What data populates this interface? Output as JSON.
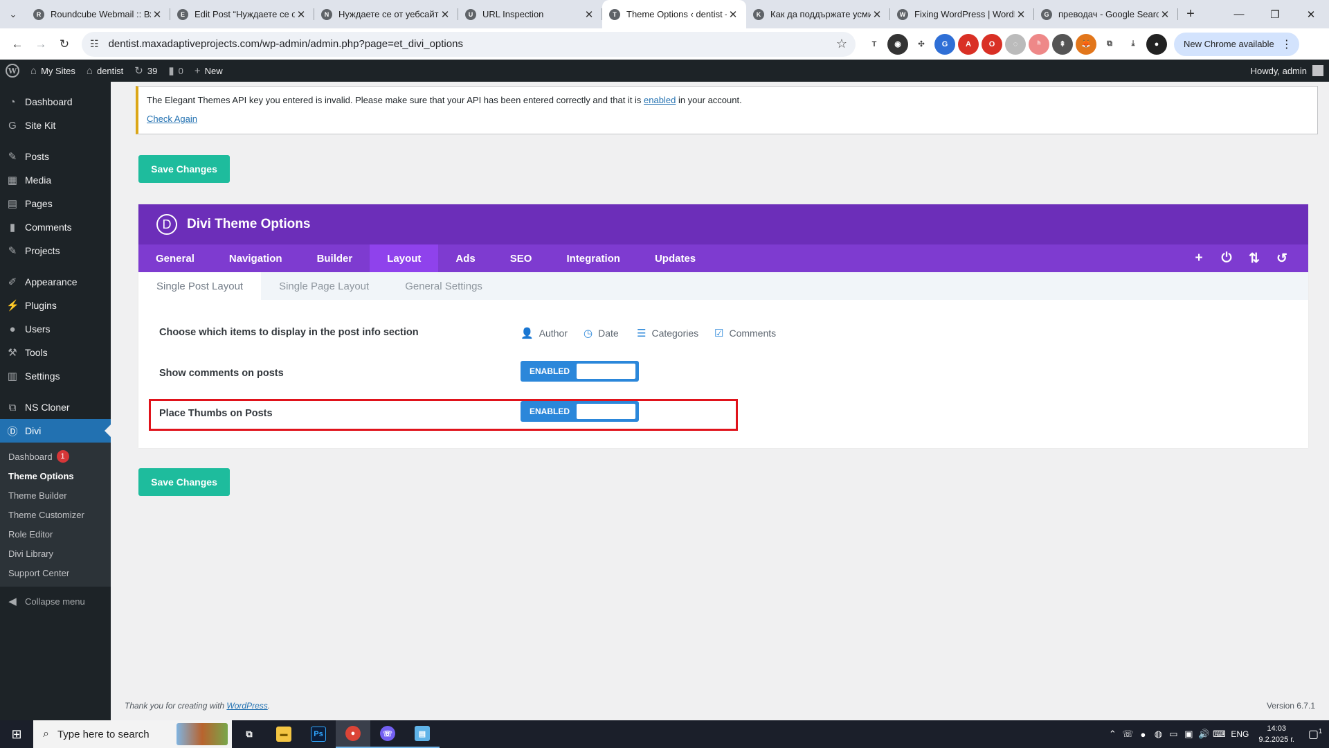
{
  "browser": {
    "tabs": [
      {
        "title": "Roundcube Webmail :: Вх",
        "favicon": "R"
      },
      {
        "title": "Edit Post “Нуждаете се от",
        "favicon": "E"
      },
      {
        "title": "Нуждаете се от уебсайт?",
        "favicon": "N"
      },
      {
        "title": "URL Inspection",
        "favicon": "U"
      },
      {
        "title": "Theme Options ‹ dentist –",
        "favicon": "T",
        "active": true
      },
      {
        "title": "Как да поддържате усми",
        "favicon": "K"
      },
      {
        "title": "Fixing WordPress | WordP",
        "favicon": "W"
      },
      {
        "title": "преводач - Google Searc",
        "favicon": "G"
      }
    ],
    "url": "dentist.maxadaptiveprojects.com/wp-admin/admin.php?page=et_divi_options",
    "new_chrome_label": "New Chrome available",
    "extensions": [
      "translate-icon",
      "accounts-icon",
      "puzzle-icon",
      "translate-g-icon",
      "adblock-icon",
      "opera-icon",
      "chat-icon",
      "tag-icon",
      "cursor-icon",
      "metamask-icon",
      "extensions-icon",
      "download-icon",
      "profile-icon"
    ]
  },
  "adminbar": {
    "my_sites": "My Sites",
    "site": "dentist",
    "updates": "39",
    "comments": "0",
    "new": "New",
    "howdy": "Howdy, admin"
  },
  "sidebar": {
    "items": [
      {
        "label": "Dashboard",
        "icon": "dashboard-icon"
      },
      {
        "label": "Site Kit",
        "icon": "sitekit-icon"
      },
      {
        "label": "Posts",
        "icon": "posts-icon"
      },
      {
        "label": "Media",
        "icon": "media-icon"
      },
      {
        "label": "Pages",
        "icon": "pages-icon"
      },
      {
        "label": "Comments",
        "icon": "comments-icon"
      },
      {
        "label": "Projects",
        "icon": "projects-icon"
      },
      {
        "label": "Appearance",
        "icon": "appearance-icon"
      },
      {
        "label": "Plugins",
        "icon": "plugins-icon"
      },
      {
        "label": "Users",
        "icon": "users-icon"
      },
      {
        "label": "Tools",
        "icon": "tools-icon"
      },
      {
        "label": "Settings",
        "icon": "settings-icon"
      },
      {
        "label": "NS Cloner",
        "icon": "cloner-icon"
      },
      {
        "label": "Divi",
        "icon": "divi-icon"
      }
    ],
    "divi_sub": [
      {
        "label": "Dashboard",
        "badge": "1"
      },
      {
        "label": "Theme Options"
      },
      {
        "label": "Theme Builder"
      },
      {
        "label": "Theme Customizer"
      },
      {
        "label": "Role Editor"
      },
      {
        "label": "Divi Library"
      },
      {
        "label": "Support Center"
      }
    ],
    "collapse": "Collapse menu"
  },
  "notice": {
    "text_before": "The Elegant Themes API key you entered is invalid. Please make sure that your API has been entered correctly and that it is ",
    "link": "enabled",
    "text_after": " in your account.",
    "check_again": "Check Again"
  },
  "save_label": "Save Changes",
  "panel": {
    "logo": "D",
    "title": "Divi Theme Options",
    "tabs": [
      "General",
      "Navigation",
      "Builder",
      "Layout",
      "Ads",
      "SEO",
      "Integration",
      "Updates"
    ],
    "active_tab": "Layout",
    "subtabs": [
      "Single Post Layout",
      "Single Page Layout",
      "General Settings"
    ],
    "options": {
      "postinfo_label": "Choose which items to display in the post info section",
      "postinfo_items": [
        {
          "label": "Author",
          "icon": "author-icon"
        },
        {
          "label": "Date",
          "icon": "date-icon"
        },
        {
          "label": "Categories",
          "icon": "categories-icon"
        },
        {
          "label": "Comments",
          "icon": "comments-check-icon"
        }
      ],
      "comments_label": "Show comments on posts",
      "comments_state": "ENABLED",
      "thumbs_label": "Place Thumbs on Posts",
      "thumbs_state": "ENABLED"
    }
  },
  "footer": {
    "thanks": "Thank you for creating with ",
    "wp_link": "WordPress",
    "period": ".",
    "version": "Version 6.7.1"
  },
  "taskbar": {
    "search_placeholder": "Type here to search",
    "lang": "ENG",
    "time": "14:03",
    "date": "9.2.2025 г.",
    "notif_count": "1"
  }
}
